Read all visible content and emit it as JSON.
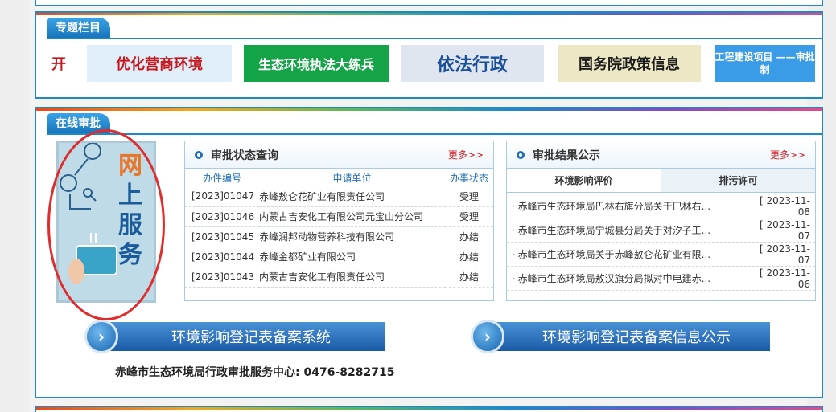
{
  "special": {
    "tag": "专题栏目",
    "banners": [
      {
        "text": "开",
        "bg": "#ffffff",
        "color": "#c8161d"
      },
      {
        "text": "优化营商环境",
        "bg": "#dfeef8",
        "color": "#c8161d"
      },
      {
        "text": "生态环境执法大练兵",
        "bg": "#14a347",
        "color": "#ffffff"
      },
      {
        "text": "依法行政",
        "bg": "#dfe6ef",
        "color": "#1a4f9c"
      },
      {
        "text": "国务院政策信息",
        "bg": "#ece7c4",
        "color": "#1c1c1c"
      },
      {
        "text": "工程建设项目 ——审批制",
        "bg": "#3a9be6",
        "color": "#ffffff"
      }
    ]
  },
  "approval": {
    "tag": "在线审批",
    "service": {
      "chars": [
        "网",
        "上",
        "服",
        "务"
      ]
    },
    "status": {
      "title": "审批状态查询",
      "more": "更多>>",
      "headers": [
        "办件编号",
        "申请单位",
        "办事状态"
      ],
      "rows": [
        [
          "[2023]01047",
          "赤峰敖仑花矿业有限责任公司",
          "受理"
        ],
        [
          "[2023]01046",
          "内蒙古吉安化工有限公司元宝山分公司",
          "受理"
        ],
        [
          "[2023]01045",
          "赤峰润邦动物营养科技有限公司",
          "办结"
        ],
        [
          "[2023]01044",
          "赤峰金都矿业有限公司",
          "办结"
        ],
        [
          "[2023]01043",
          "内蒙古吉安化工有限责任公司",
          "办结"
        ]
      ]
    },
    "results": {
      "title": "审批结果公示",
      "more": "更多>>",
      "tabs": [
        "环境影响评价",
        "排污许可"
      ],
      "items": [
        {
          "title": "· 赤峰市生态环境局巴林右旗分局关于巴林右...",
          "date": "[ 2023-11-08"
        },
        {
          "title": "· 赤峰市生态环境局宁城县分局关于对汐子工...",
          "date": "[ 2023-11-07"
        },
        {
          "title": "· 赤峰市生态环境局关于赤峰敖仑花矿业有限...",
          "date": "[ 2023-11-07"
        },
        {
          "title": "· 赤峰市生态环境局敖汉旗分局拟对中电建赤...",
          "date": "[ 2023-11-06"
        }
      ]
    },
    "btn1": "环境影响登记表备案系统",
    "btn2": "环境影响登记表备案信息公示",
    "contact": "赤峰市生态环境局行政审批服务中心:   0476-8282715"
  }
}
